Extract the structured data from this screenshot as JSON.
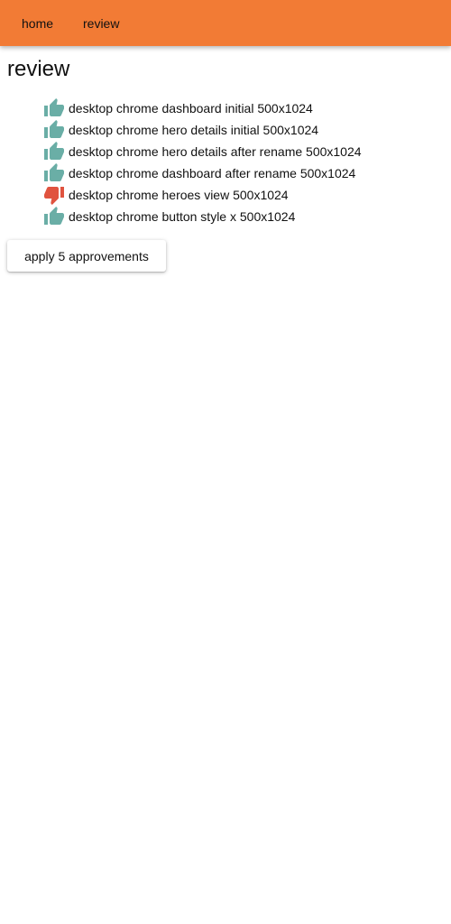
{
  "nav": {
    "home_label": "home",
    "review_label": "review"
  },
  "page": {
    "title": "review"
  },
  "colors": {
    "topbar": "#f27b35",
    "approve": "#6aaea6",
    "reject": "#e0533f"
  },
  "reviews": [
    {
      "label": "desktop chrome dashboard initial 500x1024",
      "status": "approved",
      "icon": "thumbs-up-icon"
    },
    {
      "label": "desktop chrome hero details initial 500x1024",
      "status": "approved",
      "icon": "thumbs-up-icon"
    },
    {
      "label": "desktop chrome hero details after rename 500x1024",
      "status": "approved",
      "icon": "thumbs-up-icon"
    },
    {
      "label": "desktop chrome dashboard after rename 500x1024",
      "status": "approved",
      "icon": "thumbs-up-icon"
    },
    {
      "label": "desktop chrome heroes view 500x1024",
      "status": "rejected",
      "icon": "thumbs-down-icon"
    },
    {
      "label": "desktop chrome button style x 500x1024",
      "status": "approved",
      "icon": "thumbs-up-icon"
    }
  ],
  "actions": {
    "apply_label": "apply 5 approvements"
  }
}
